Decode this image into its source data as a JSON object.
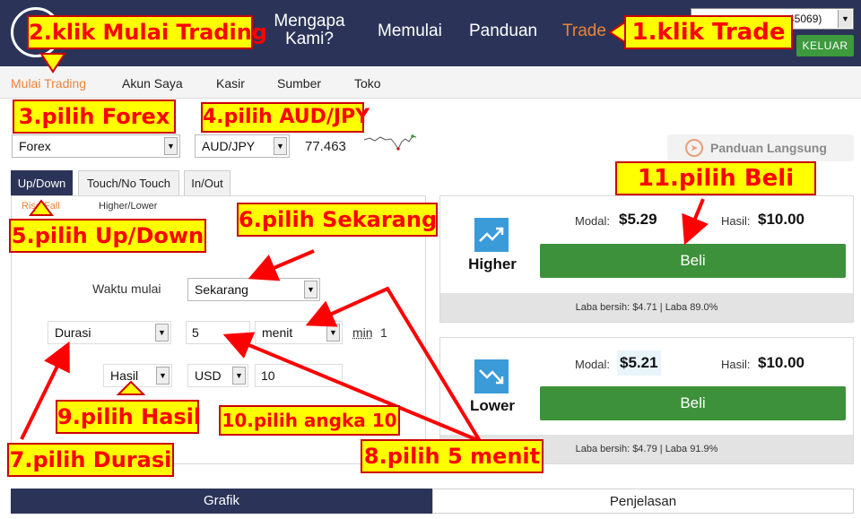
{
  "header": {
    "nav": {
      "mengapa": "Mengapa Kami?",
      "memulai": "Memulai",
      "panduan": "Panduan",
      "trade": "Trade"
    },
    "account_select_value": "45069)",
    "logout_label": "KELUAR"
  },
  "subnav": {
    "items": [
      "Mulai Trading",
      "Akun Saya",
      "Kasir",
      "Sumber",
      "Toko"
    ]
  },
  "market": {
    "market_value": "Forex",
    "asset_value": "AUD/JPY",
    "price": "77.463"
  },
  "guide": {
    "label": "Panduan Langsung"
  },
  "tabs": {
    "items": [
      "Up/Down",
      "Touch/No Touch",
      "In/Out"
    ],
    "subtabs": [
      "Rise/Fall",
      "Higher/Lower"
    ]
  },
  "form": {
    "start_label": "Waktu mulai",
    "start_value": "Sekarang",
    "duration_type": "Durasi",
    "duration_value": "5",
    "duration_unit": "menit",
    "min_label": "min",
    "min_value": "1",
    "payout_type": "Hasil",
    "currency": "USD",
    "amount": "10"
  },
  "cards": {
    "higher": {
      "label": "Higher",
      "modal_label": "Modal:",
      "modal_value": "$5.29",
      "hasil_label": "Hasil:",
      "hasil_value": "$10.00",
      "button_label": "Beli",
      "footer": "Laba bersih: $4.71 | Laba 89.0%"
    },
    "lower": {
      "label": "Lower",
      "modal_label": "Modal:",
      "modal_value": "$5.21",
      "hasil_label": "Hasil:",
      "hasil_value": "$10.00",
      "button_label": "Beli",
      "footer": "Laba bersih: $4.79 | Laba 91.9%"
    }
  },
  "bottom_tabs": {
    "chart": "Grafik",
    "explanation": "Penjelasan"
  },
  "annotations": {
    "step1": "1.klik Trade",
    "step2": "2.klik Mulai Trading",
    "step3": "3.pilih Forex",
    "step4": "4.pilih AUD/JPY",
    "step5": "5.pilih Up/Down",
    "step6": "6.pilih Sekarang",
    "step7": "7.pilih Durasi",
    "step8": "8.pilih 5 menit",
    "step9": "9.pilih Hasil",
    "step10": "10.pilih angka 10",
    "step11": "11.pilih Beli"
  },
  "colors": {
    "header_bg": "#2b3458",
    "accent_orange": "#e8843a",
    "buy_green": "#3d913b",
    "callout_yellow": "#ffff00",
    "callout_red": "#ff0000",
    "direction_blue": "#3a9bd8"
  }
}
